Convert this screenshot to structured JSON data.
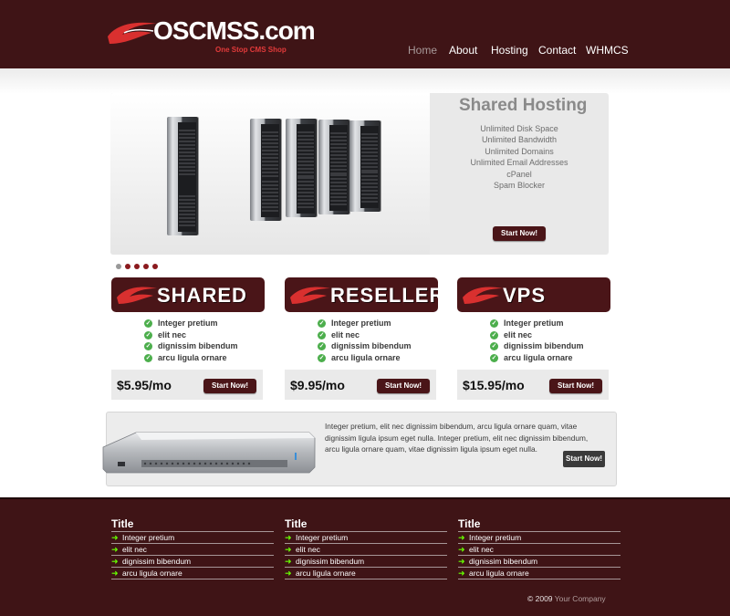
{
  "colors": {
    "header_bg": "#3f1416",
    "accent": "#4a1518",
    "brand_red": "#e23a3a",
    "check_green": "#4cae4c",
    "arrow_green": "#66ff00"
  },
  "header": {
    "logo_text": "OSCMSS.com",
    "tagline": "One Stop CMS Shop",
    "nav": [
      "Home",
      "About",
      "Hosting",
      "Contact",
      "WHMCS"
    ],
    "active_nav": "Home"
  },
  "slider": {
    "title": "Shared Hosting",
    "features": [
      "Unlimited Disk Space",
      "Unlimited Bandwidth",
      "Unlimited Domains",
      "Unlimited Email Addresses",
      "cPanel",
      "Spam Blocker"
    ],
    "button": "Start Now!",
    "image_icon": "server-towers-icon",
    "dot_count": 5
  },
  "plans": [
    {
      "name": "SHARED",
      "features": [
        "Integer pretium",
        "elit nec",
        "dignissim bibendum",
        "arcu ligula ornare"
      ],
      "price": "$5.95/mo",
      "button": "Start Now!"
    },
    {
      "name": "RESELLER",
      "features": [
        "Integer pretium",
        "elit nec",
        "dignissim bibendum",
        "arcu ligula ornare"
      ],
      "price": "$9.95/mo",
      "button": "Start Now!"
    },
    {
      "name": "VPS",
      "features": [
        "Integer pretium",
        "elit nec",
        "dignissim bibendum",
        "arcu ligula ornare"
      ],
      "price": "$15.95/mo",
      "button": "Start Now!"
    }
  ],
  "promo": {
    "text": "Integer pretium, elit nec dignissim bibendum, arcu ligula ornare quam, vitae dignissim ligula ipsum eget nulla. Integer pretium, elit nec dignissim bibendum, arcu ligula ornare quam, vitae dignissim ligula ipsum eget nulla.",
    "button": "Start Now!",
    "image_icon": "rack-server-icon"
  },
  "footer": {
    "columns": [
      {
        "title": "Title",
        "items": [
          "Integer pretium",
          "elit nec",
          "dignissim bibendum",
          "arcu ligula ornare"
        ]
      },
      {
        "title": "Title",
        "items": [
          "Integer pretium",
          "elit nec",
          "dignissim bibendum",
          "arcu ligula ornare"
        ]
      },
      {
        "title": "Title",
        "items": [
          "Integer pretium",
          "elit nec",
          "dignissim bibendum",
          "arcu ligula ornare"
        ]
      }
    ],
    "copyright_prefix": "© 2009",
    "company": "Your Company"
  }
}
